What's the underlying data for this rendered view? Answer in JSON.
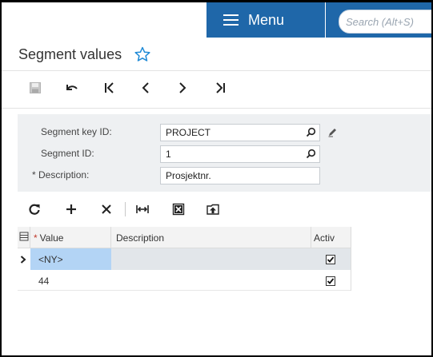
{
  "header": {
    "menu_label": "Menu",
    "search_placeholder": "Search (Alt+S)"
  },
  "page": {
    "title": "Segment values"
  },
  "toolbar": {
    "icons": [
      "save-icon",
      "undo-icon",
      "first-record-icon",
      "previous-record-icon",
      "next-record-icon",
      "last-record-icon"
    ]
  },
  "form": {
    "segment_key_label": "Segment key ID:",
    "segment_key_value": "PROJECT",
    "segment_id_label": "Segment ID:",
    "segment_id_value": "1",
    "description_label": "Description:",
    "description_required": "*",
    "description_value": "Prosjektnr."
  },
  "grid_toolbar": {
    "icons": [
      "refresh-icon",
      "add-icon",
      "delete-icon",
      "fit-columns-icon",
      "export-excel-icon",
      "upload-icon"
    ]
  },
  "grid": {
    "columns": {
      "value_required": "*",
      "value": "Value",
      "description": "Description",
      "active": "Activ"
    },
    "rows": [
      {
        "value": "<NY>",
        "description": "",
        "active": true,
        "selected": true
      },
      {
        "value": "44",
        "description": "",
        "active": true,
        "selected": false
      }
    ]
  },
  "colors": {
    "accent": "#1f67a9",
    "selected_row": "#e2e6ea",
    "selected_cell": "#b3d4f5"
  }
}
